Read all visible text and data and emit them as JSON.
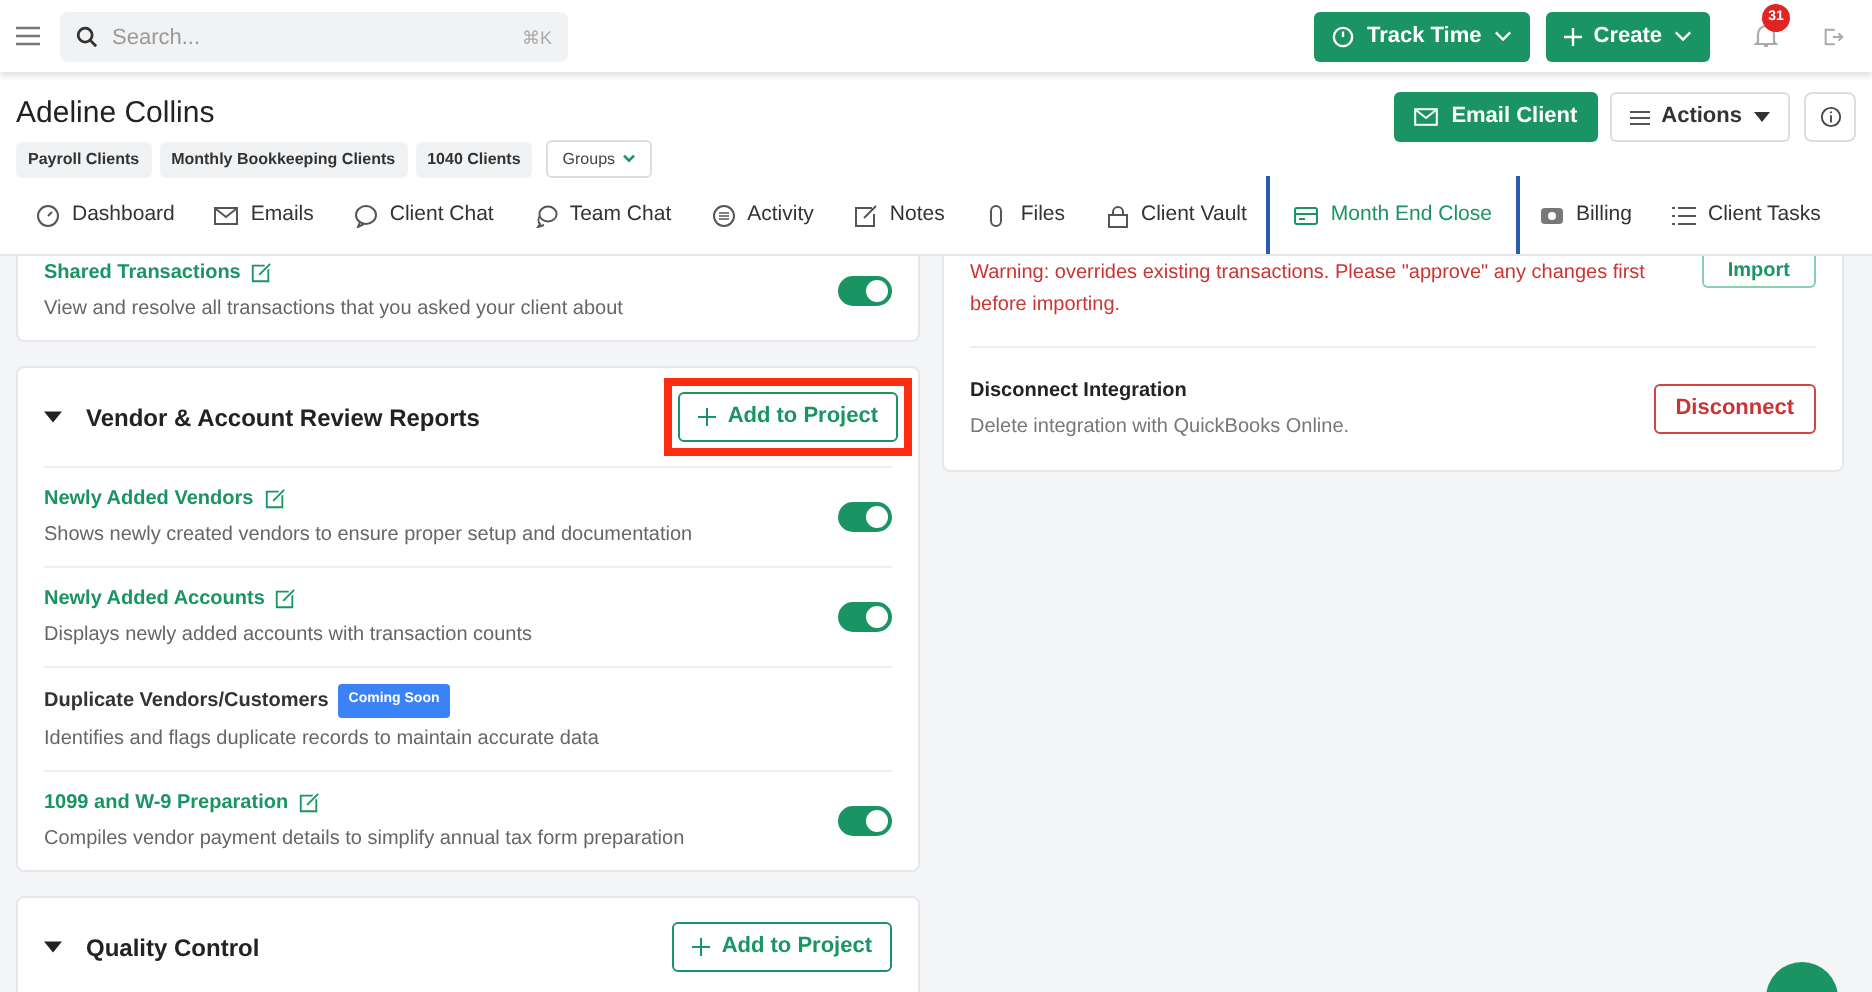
{
  "topbar": {
    "search": {
      "placeholder": "Search...",
      "shortcut": "⌘K"
    },
    "buttons": [
      {
        "label": "Track Time",
        "kind": "timer"
      },
      {
        "label": "Create",
        "kind": "create"
      }
    ],
    "notifications": "31"
  },
  "client": {
    "name": "Adeline Collins",
    "tags": [
      "Payroll Clients",
      "Monthly Bookkeeping Clients",
      "1040 Clients"
    ],
    "groups_button": "Groups",
    "actions": [
      {
        "label": "Email Client",
        "kind": "email"
      },
      {
        "label": "Actions",
        "kind": "menu"
      }
    ]
  },
  "tabs": [
    {
      "label": "Dashboard",
      "kind": "dashboard",
      "selected": false
    },
    {
      "label": "Emails",
      "kind": "mail",
      "selected": false
    },
    {
      "label": "Client Chat",
      "kind": "chat",
      "selected": false
    },
    {
      "label": "Team Chat",
      "kind": "chats",
      "selected": false
    },
    {
      "label": "Activity",
      "kind": "list",
      "selected": false
    },
    {
      "label": "Notes",
      "kind": "note",
      "selected": false
    },
    {
      "label": "Files",
      "kind": "clip",
      "selected": false
    },
    {
      "label": "Client Vault",
      "kind": "lock",
      "selected": false
    },
    {
      "label": "Month End Close",
      "kind": "card",
      "selected": true
    },
    {
      "label": "Billing",
      "kind": "money",
      "selected": false
    },
    {
      "label": "Client Tasks",
      "kind": "tasks",
      "selected": false
    }
  ],
  "sections": [
    {
      "items": [
        {
          "kind": "report",
          "title": "Shared Transactions",
          "description": "View and resolve all transactions that you asked your client about",
          "on": true
        }
      ]
    },
    {
      "title": "Vendor & Account Review Reports",
      "expanded": true,
      "button": {
        "label": "Add to Project",
        "highlighted": true
      },
      "items": [
        {
          "kind": "report",
          "title": "Newly Added Vendors",
          "description": "Shows newly created vendors to ensure proper setup and documentation",
          "on": true
        },
        {
          "kind": "report",
          "title": "Newly Added Accounts",
          "description": "Displays newly added accounts with transaction counts",
          "on": true
        },
        {
          "kind": "coming_soon",
          "title": "Duplicate Vendors/Customers",
          "badge": "Coming Soon",
          "description": "Identifies and flags duplicate records to maintain accurate data"
        },
        {
          "kind": "report",
          "title": "1099 and W-9 Preparation",
          "description": "Compiles vendor payment details to simplify annual tax form preparation",
          "on": true
        }
      ]
    },
    {
      "title": "Quality Control",
      "expanded": true,
      "button": {
        "label": "Add to Project",
        "highlighted": false
      }
    }
  ],
  "integration": {
    "import": {
      "warning": "Warning: overrides existing transactions. Please \"approve\" any changes first before importing.",
      "button": "Import"
    },
    "disconnect": {
      "title": "Disconnect Integration",
      "description": "Delete integration with QuickBooks Online.",
      "button": "Disconnect"
    }
  }
}
